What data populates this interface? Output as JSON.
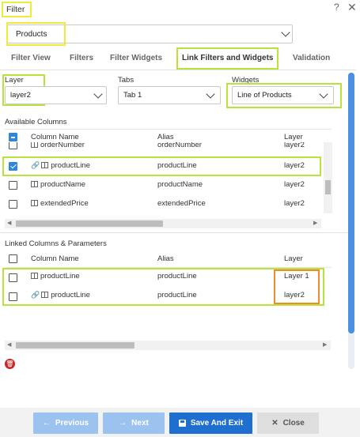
{
  "header": {
    "title": "Filter",
    "help_icon": "?",
    "close_icon": "✕"
  },
  "filter": {
    "selected": "Products"
  },
  "tabs": [
    {
      "label": "Filter View"
    },
    {
      "label": "Filters"
    },
    {
      "label": "Filter Widgets"
    },
    {
      "label": "Link Filters and Widgets"
    },
    {
      "label": "Validation"
    }
  ],
  "selectors": {
    "layer": {
      "label": "Layer",
      "value": "layer2"
    },
    "tabs": {
      "label": "Tabs",
      "value": "Tab 1"
    },
    "widgets": {
      "label": "Widgets",
      "value": "Line of Products"
    }
  },
  "available": {
    "title": "Available Columns",
    "headers": {
      "name": "Column Name",
      "alias": "Alias",
      "layer": "Layer"
    },
    "rows": [
      {
        "name": "orderNumber",
        "alias": "orderNumber",
        "layer": "layer2",
        "checked": false,
        "linked": false
      },
      {
        "name": "productLine",
        "alias": "productLine",
        "layer": "layer2",
        "checked": true,
        "linked": true
      },
      {
        "name": "productName",
        "alias": "productName",
        "layer": "layer2",
        "checked": false,
        "linked": false
      },
      {
        "name": "extendedPrice",
        "alias": "extendedPrice",
        "layer": "layer2",
        "checked": false,
        "linked": false
      }
    ]
  },
  "linked": {
    "title": "Linked Columns & Parameters",
    "headers": {
      "name": "Column Name",
      "alias": "Alias",
      "layer": "Layer"
    },
    "rows": [
      {
        "name": "productLine",
        "alias": "productLine",
        "layer": "Layer 1",
        "linked": false
      },
      {
        "name": "productLine",
        "alias": "productLine",
        "layer": "layer2",
        "linked": true
      }
    ]
  },
  "footer": {
    "previous": "Previous",
    "next": "Next",
    "save": "Save And Exit",
    "close": "Close"
  },
  "colors": {
    "accent": "#1f6fd1",
    "highlight_yellow": "#f3e93a",
    "highlight_green": "#b9e23a",
    "highlight_orange": "#f08a2a"
  }
}
